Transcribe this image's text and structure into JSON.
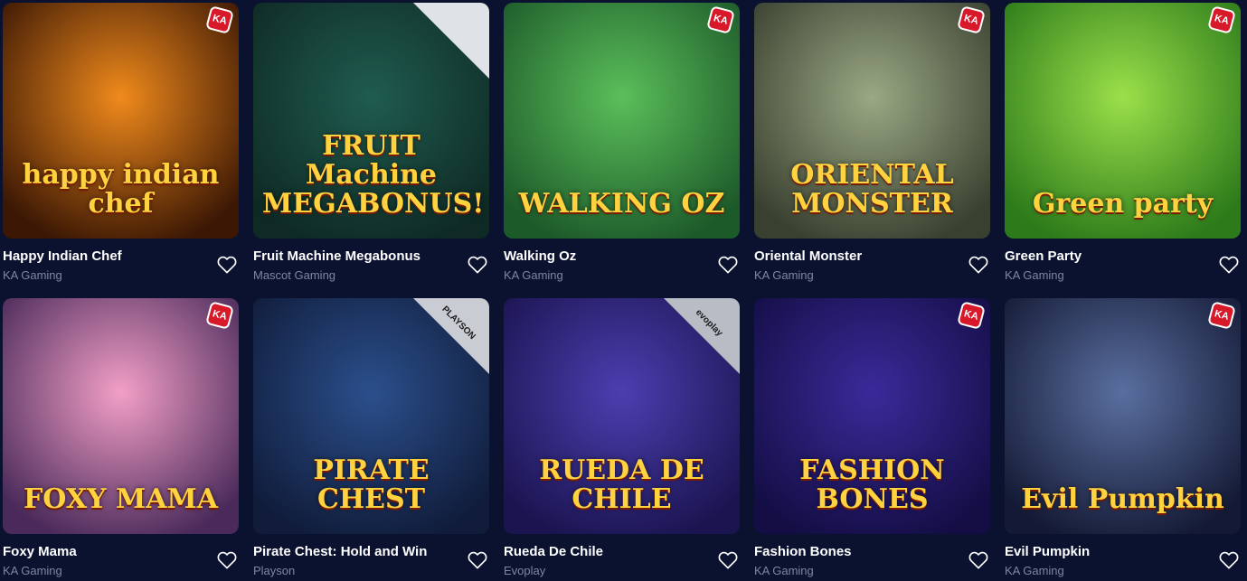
{
  "games": [
    {
      "name": "Happy Indian Chef",
      "provider": "KA Gaming",
      "art_title": "happy indian chef",
      "bg": "#f08a1c",
      "bg2": "#3b1704",
      "ribbon": "ka",
      "ribbon_label": "KA"
    },
    {
      "name": "Fruit Machine Megabonus",
      "provider": "Mascot Gaming",
      "art_title": "FRUIT Machine MEGABONUS!",
      "bg": "#1f5c4f",
      "bg2": "#0f2a25",
      "ribbon": "corner",
      "ribbon_label": "",
      "ribbon_color": "#dfe3e8"
    },
    {
      "name": "Walking Oz",
      "provider": "KA Gaming",
      "art_title": "WALKING OZ",
      "bg": "#5bbf5a",
      "bg2": "#1d5a2a",
      "ribbon": "ka",
      "ribbon_label": "KA"
    },
    {
      "name": "Oriental Monster",
      "provider": "KA Gaming",
      "art_title": "ORIENTAL MONSTER",
      "bg": "#9aa884",
      "bg2": "#3a4030",
      "ribbon": "ka",
      "ribbon_label": "KA"
    },
    {
      "name": "Green Party",
      "provider": "KA Gaming",
      "art_title": "Green party",
      "bg": "#9be04a",
      "bg2": "#2c7a1a",
      "ribbon": "ka",
      "ribbon_label": "KA"
    },
    {
      "name": "Foxy Mama",
      "provider": "KA Gaming",
      "art_title": "FOXY MAMA",
      "bg": "#f29fc6",
      "bg2": "#4a2a5a",
      "ribbon": "ka",
      "ribbon_label": "KA"
    },
    {
      "name": "Pirate Chest: Hold and Win",
      "provider": "Playson",
      "art_title": "PIRATE CHEST",
      "bg": "#2b4f8c",
      "bg2": "#101c3a",
      "ribbon": "corner",
      "ribbon_label": "PLAYSON",
      "ribbon_color": "#c9ccd2"
    },
    {
      "name": "Rueda De Chile",
      "provider": "Evoplay",
      "art_title": "RUEDA DE CHILE",
      "bg": "#4b3fb0",
      "bg2": "#1b1450",
      "ribbon": "corner",
      "ribbon_label": "evoplay",
      "ribbon_color": "#b8bcc4"
    },
    {
      "name": "Fashion Bones",
      "provider": "KA Gaming",
      "art_title": "FASHION BONES",
      "bg": "#3a2a9a",
      "bg2": "#140e45",
      "ribbon": "ka",
      "ribbon_label": "KA"
    },
    {
      "name": "Evil Pumpkin",
      "provider": "KA Gaming",
      "art_title": "Evil Pumpkin",
      "bg": "#5a6fa0",
      "bg2": "#141a35",
      "ribbon": "ka",
      "ribbon_label": "KA"
    }
  ],
  "icons": {
    "favorite": "heart-outline-icon"
  },
  "colors": {
    "background": "#0b1230",
    "provider_text": "#7e86a3"
  }
}
